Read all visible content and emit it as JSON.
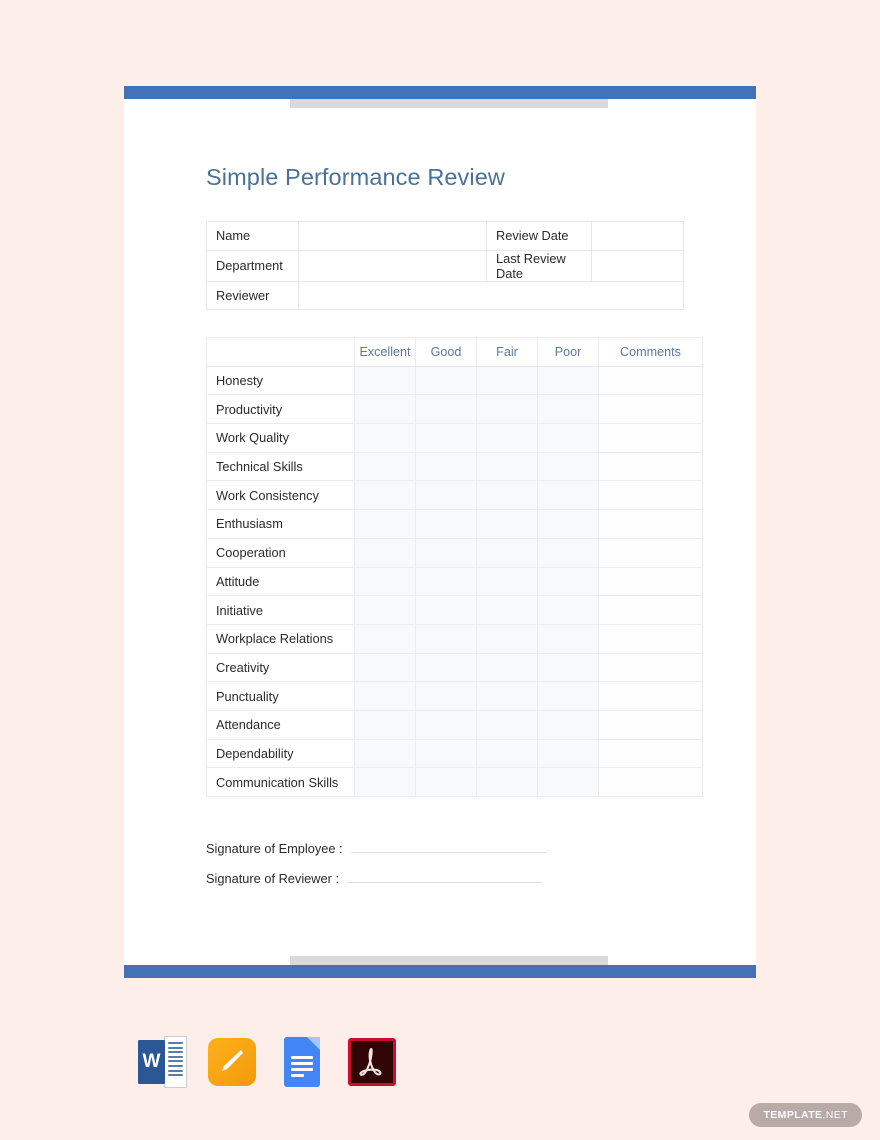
{
  "document": {
    "title": "Simple Performance Review",
    "accent_bar_color": "#4472b8",
    "tab_color": "#d8d9db",
    "title_color": "#4a7299",
    "page_background": "#fdeee9",
    "sheet_background": "#ffffff"
  },
  "info_table": {
    "rows": [
      {
        "label": "Name",
        "value": "",
        "label2": "Review Date",
        "value2": ""
      },
      {
        "label": "Department",
        "value": "",
        "label2": "Last Review Date",
        "value2": ""
      },
      {
        "label": "Reviewer",
        "value": "",
        "label2": "",
        "value2": ""
      }
    ]
  },
  "rating_table": {
    "header_color": "#5b7a9d",
    "columns": [
      "",
      "Excellent",
      "Good",
      "Fair",
      "Poor",
      "Comments"
    ],
    "criteria": [
      "Honesty",
      "Productivity",
      "Work Quality",
      "Technical Skills",
      "Work Consistency",
      "Enthusiasm",
      "Cooperation",
      "Attitude",
      "Initiative",
      "Workplace Relations",
      "Creativity",
      "Punctuality",
      "Attendance",
      "Dependability",
      "Communication Skills"
    ]
  },
  "signatures": [
    {
      "label": "Signature of Employee :",
      "value": ""
    },
    {
      "label": "Signature of Reviewer :",
      "value": ""
    }
  ],
  "format_icons": [
    {
      "name": "microsoft-word-icon",
      "label": "W",
      "title": "MS Word"
    },
    {
      "name": "apple-pages-icon",
      "label": "",
      "title": "Apple Pages"
    },
    {
      "name": "google-docs-icon",
      "label": "",
      "title": "Google Docs"
    },
    {
      "name": "adobe-pdf-icon",
      "label": "",
      "title": "PDF"
    }
  ],
  "footer": {
    "badge_prefix": "TEMPLATE",
    "badge_suffix": ".NET",
    "badge_color": "#b8aaa6"
  }
}
